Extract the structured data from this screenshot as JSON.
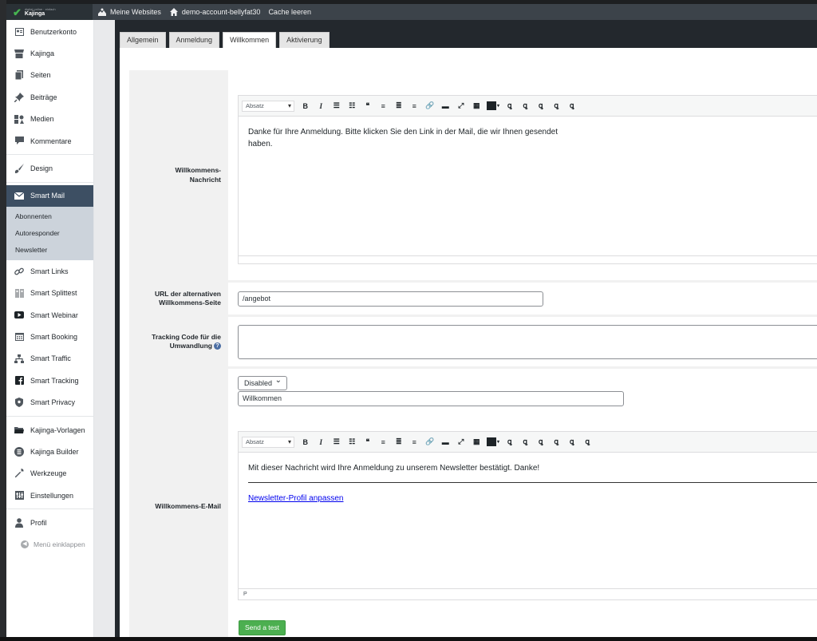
{
  "adminbar": {
    "logo_tag": "digital online · einfach",
    "logo_name": "Kajinga",
    "items": [
      {
        "icon": "sites-icon",
        "label": "Meine Websites"
      },
      {
        "icon": "home-icon",
        "label": "demo-account-bellyfat30"
      },
      {
        "icon": "",
        "label": "Cache leeren"
      }
    ]
  },
  "sidebar": {
    "items": [
      {
        "icon": "user-card-icon",
        "label": "Benutzerkonto"
      },
      {
        "icon": "store-icon",
        "label": "Kajinga"
      },
      {
        "icon": "pages-icon",
        "label": "Seiten"
      },
      {
        "icon": "pin-icon",
        "label": "Beiträge"
      },
      {
        "icon": "media-icon",
        "label": "Medien"
      },
      {
        "icon": "comment-icon",
        "label": "Kommentare"
      },
      {
        "icon": "brush-icon",
        "label": "Design"
      },
      {
        "icon": "mail-icon",
        "label": "Smart Mail"
      },
      {
        "icon": "link-icon",
        "label": "Smart Links"
      },
      {
        "icon": "split-icon",
        "label": "Smart Splittest"
      },
      {
        "icon": "video-icon",
        "label": "Smart Webinar"
      },
      {
        "icon": "calendar-icon",
        "label": "Smart Booking"
      },
      {
        "icon": "network-icon",
        "label": "Smart Traffic"
      },
      {
        "icon": "facebook-icon",
        "label": "Smart Tracking"
      },
      {
        "icon": "shield-icon",
        "label": "Smart Privacy"
      },
      {
        "icon": "folder-icon",
        "label": "Kajinga-Vorlagen"
      },
      {
        "icon": "builder-icon",
        "label": "Kajinga Builder"
      },
      {
        "icon": "wrench-icon",
        "label": "Werkzeuge"
      },
      {
        "icon": "settings-icon",
        "label": "Einstellungen"
      },
      {
        "icon": "profile-icon",
        "label": "Profil"
      }
    ],
    "submenu": [
      "Abonnenten",
      "Autoresponder",
      "Newsletter"
    ],
    "collapse_label": "Menü einklappen"
  },
  "tabs": [
    "Allgemein",
    "Anmeldung",
    "Willkommen",
    "Aktivierung"
  ],
  "form": {
    "welcome_label": "Willkommens-Nachricht",
    "welcome_format": "Absatz",
    "welcome_text": "Danke für Ihre Anmeldung. Bitte klicken Sie den Link in der Mail, die wir Ihnen gesendet haben.",
    "alt_url_label": "URL der alternativen Willkommens-Seite",
    "alt_url_value": "/angebot",
    "tracking_label": "Tracking Code für die Umwandlung",
    "help_glyph": "?",
    "email_label": "Willkommens-E-Mail",
    "email_status": "Disabled",
    "email_subject": "Willkommen",
    "email_format": "Absatz",
    "email_text": "Mit dieser Nachricht wird Ihre Anmeldung zu unserem Newsletter bestätigt. Danke!",
    "email_link": "Newsletter-Profil anpassen",
    "email_path": "P",
    "send_test": "Send a test"
  }
}
